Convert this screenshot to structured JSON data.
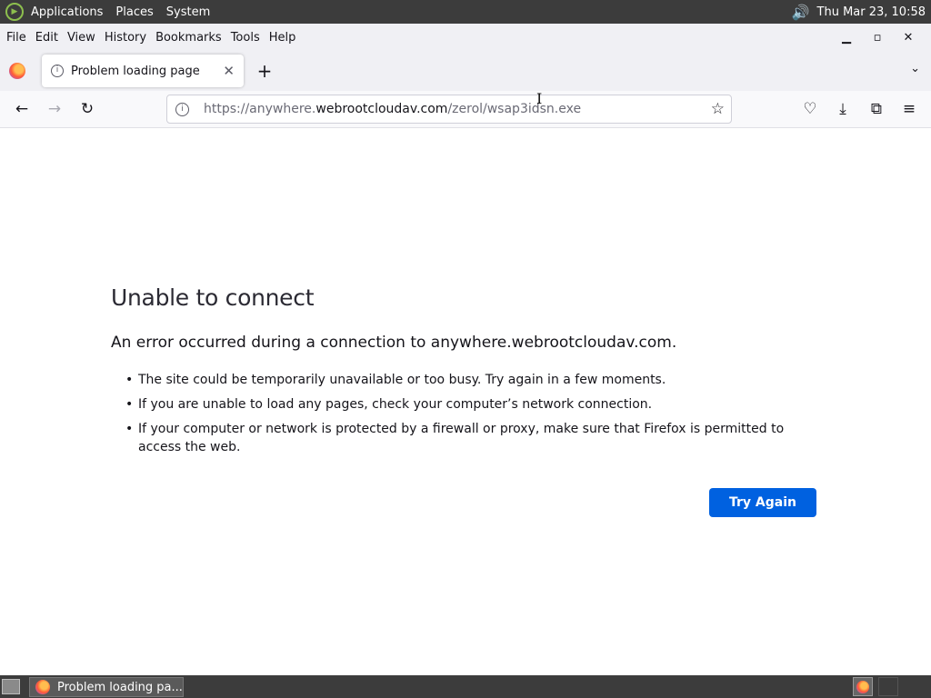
{
  "desktop": {
    "menus": [
      "Applications",
      "Places",
      "System"
    ],
    "clock": "Thu Mar 23, 10:58"
  },
  "menubar": [
    {
      "label": "File"
    },
    {
      "label": "Edit"
    },
    {
      "label": "View"
    },
    {
      "label": "History"
    },
    {
      "label": "Bookmarks"
    },
    {
      "label": "Tools"
    },
    {
      "label": "Help"
    }
  ],
  "window_controls": {
    "minimize": "▁",
    "maximize": "▫",
    "close": "✕"
  },
  "tab": {
    "title": "Problem loading page",
    "close": "✕"
  },
  "new_tab": "+",
  "tab_list": "⌄",
  "url": {
    "prefix": "https://anywhere.",
    "host": "webrootcloudav.com",
    "path": "/zerol/wsap3idsn.exe"
  },
  "error": {
    "title": "Unable to connect",
    "description": "An error occurred during a connection to anywhere.webrootcloudav.com.",
    "items": [
      "The site could be temporarily unavailable or too busy. Try again in a few moments.",
      "If you are unable to load any pages, check your computer’s network connection.",
      "If your computer or network is protected by a firewall or proxy, make sure that Firefox is permitted to access the web."
    ],
    "button": "Try Again"
  },
  "taskbar": {
    "task_label": "Problem loading pa..."
  },
  "colors": {
    "accent": "#0061e0",
    "panel": "#3c3c3c"
  }
}
